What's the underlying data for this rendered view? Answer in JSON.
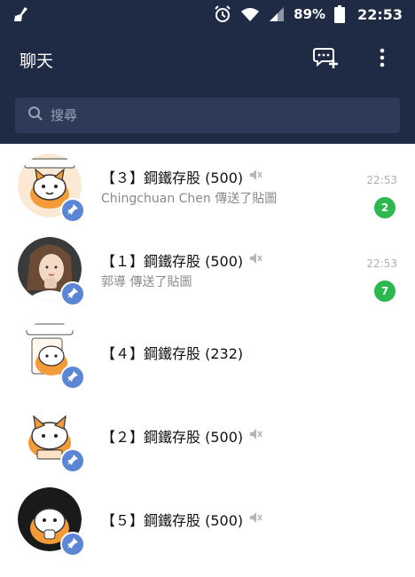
{
  "status_bar": {
    "battery_percent": "89%",
    "time": "22:53",
    "icons": [
      "broom-icon",
      "alarm-icon",
      "wifi-icon",
      "signal-icon",
      "battery-icon"
    ]
  },
  "header": {
    "title": "聊天",
    "actions": [
      "new-chat-icon",
      "more-vert-icon"
    ]
  },
  "search": {
    "placeholder": "搜尋"
  },
  "chats": [
    {
      "name": "【３】鋼鐵存股 (500)",
      "preview": "Chingchuan Chen 傳送了貼圖",
      "time": "22:53",
      "unread": "2",
      "muted": true,
      "pinned": true,
      "avatar": "cat-sticker-avatar"
    },
    {
      "name": "【１】鋼鐵存股 (500)",
      "preview": "郭導 傳送了貼圖",
      "time": "22:53",
      "unread": "7",
      "muted": true,
      "pinned": true,
      "avatar": "person-photo-avatar"
    },
    {
      "name": "【４】鋼鐵存股 (232)",
      "preview": "",
      "time": "",
      "unread": "",
      "muted": false,
      "pinned": true,
      "avatar": "cat-sticker-avatar"
    },
    {
      "name": "【２】鋼鐵存股 (500)",
      "preview": "",
      "time": "",
      "unread": "",
      "muted": true,
      "pinned": true,
      "avatar": "cat-sticker-avatar"
    },
    {
      "name": "【５】鋼鐵存股 (500)",
      "preview": "",
      "time": "",
      "unread": "",
      "muted": true,
      "pinned": true,
      "avatar": "cat-sticker-avatar"
    }
  ],
  "colors": {
    "header_bg": "#1f2a44",
    "search_bg": "#2e3a57",
    "pin_badge": "#5b86d6",
    "unread_badge": "#2db84e"
  }
}
